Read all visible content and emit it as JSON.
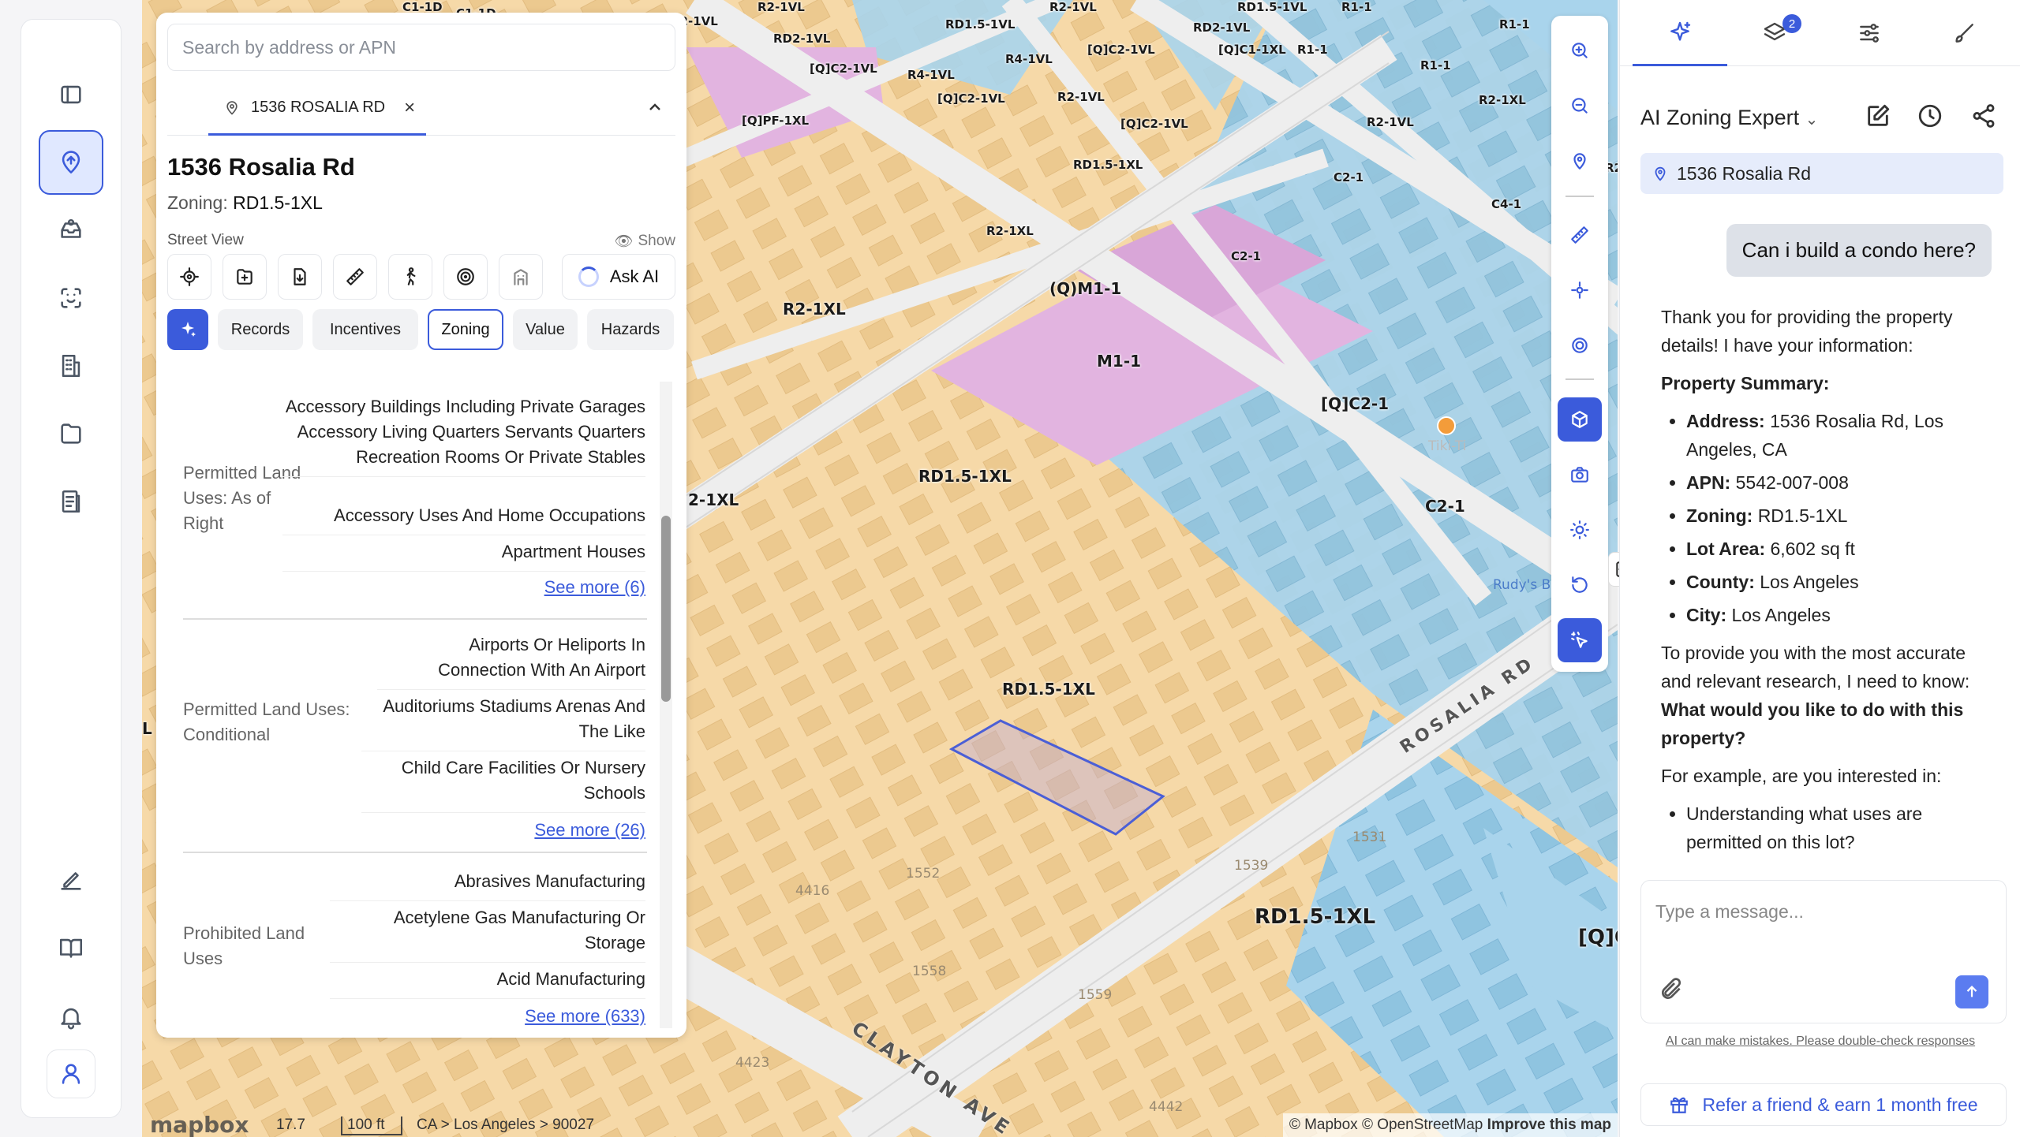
{
  "rail": {
    "items": [
      "sidebar-toggle",
      "map",
      "inbox",
      "ai-scan",
      "buildings",
      "folder",
      "reports",
      "edit",
      "guide",
      "notifications",
      "profile"
    ]
  },
  "panel": {
    "search_placeholder": "Search by address or APN",
    "tab_label": "1536 ROSALIA RD",
    "title": "1536 Rosalia Rd",
    "zoning_label": "Zoning:",
    "zoning_value": "RD1.5-1XL",
    "street_view": "Street View",
    "show": "Show",
    "ask_ai": "Ask AI",
    "tabs": [
      "Records",
      "Incentives",
      "Zoning",
      "Value",
      "Hazards"
    ],
    "selected_tab": "Zoning",
    "sections": [
      {
        "label": "Permitted Land Uses: As of Right",
        "items": [
          "Accessory Buildings Including Private Garages Accessory Living Quarters Servants Quarters Recreation Rooms Or Private Stables",
          "Accessory Uses And Home Occupations",
          "Apartment Houses"
        ],
        "more": "See more (6)"
      },
      {
        "label": "Permitted Land Uses: Conditional",
        "items": [
          "Airports Or Heliports In Connection With An Airport",
          "Auditoriums Stadiums Arenas And The Like",
          "Child Care Facilities Or Nursery Schools"
        ],
        "more": "See more (26)"
      },
      {
        "label": "Prohibited Land Uses",
        "items": [
          "Abrasives Manufacturing",
          "Acetylene Gas Manufacturing Or Storage",
          "Acid Manufacturing"
        ],
        "more": "See more (633)"
      }
    ]
  },
  "map": {
    "labels": {
      "rd15_top": "RD1.5-1XL",
      "rd15_mid": "RD1.5-1XL",
      "rd15_sel": "RD1.5-1XL",
      "rd15_bot": "RD1.5-1XL",
      "r21xl": "R2-1XL",
      "r21xl_b": "R2-1XL",
      "r21xl_c": "2-1XL",
      "m11": "M1-1",
      "qm11": "(Q)M1-1",
      "c21_a": "C2-1",
      "c21_b": "C2-1",
      "qc21": "[Q]C2-1",
      "c21_c": "C2-1",
      "c41": "C4-1",
      "qc_right": "[Q]C",
      "l_left": "L",
      "r2_1vl_a": "R2-1VL",
      "rd2_1vl": "RD2-1VL",
      "qc21vl_a": "[Q]C2-1VL",
      "qc21vl_b": "[Q]C2-1VL",
      "qc21vl_c": "[Q]C2-1VL",
      "r41vl": "R4-1VL",
      "r41vl_b": "R4-1VL",
      "qpf": "[Q]PF-1XL",
      "qc11vl": "[Q]C1-1XL",
      "r11": "R1-1",
      "r11_b": "R1-1",
      "r11_c": "R1-1",
      "r21vl_b": "R2-1VL",
      "rd15_1xl_s": "RD1.5-1XL",
      "rd15_1vl": "RD1.5-1VL",
      "c11d": "C1-1D",
      "c21_d": "C2-1",
      "r2_1xl_s": "R2-1XL",
      "r2_right": "R2-1XL",
      "r2_1vl_c": "R2-1VL",
      "r2_1vl_d": "R2-1VL",
      "r2_1vl_e": "R2-1VL",
      "r21xl_right": "R2-1XL",
      "r_edge": "R2",
      "rd15_1vl_b": "RD1.5-1VL",
      "rd21vl_b": "RD2-1VL",
      "c11d_b": "C1-1D",
      "qc21vl_d": "[Q]C2-1VL",
      "r11_d": "R1-1"
    },
    "streets": {
      "rosalia": "ROSALIA RD",
      "clayton": "CLAYTON AVE"
    },
    "poi": {
      "tiki": "Tiki-Ti",
      "rudys": "Rudy's B"
    },
    "addr": {
      "a4416": "4416",
      "a1552": "1552",
      "a1558": "1558",
      "a1559": "1559",
      "a1539": "1539",
      "a1531": "1531",
      "a4423": "4423",
      "a4442": "4442"
    },
    "footer": {
      "logo": "mapbox",
      "zoom": "17.7",
      "scale": "100 ft",
      "crumb": "CA > Los Angeles > 90027",
      "attr1": "© Mapbox",
      "attr2": "© OpenStreetMap",
      "attr3": "Improve this map"
    }
  },
  "chat": {
    "assistant": "AI Zoning Expert",
    "layers_badge": "2",
    "address": "1536 Rosalia Rd",
    "user_msg": "Can i build a condo here?",
    "reply": {
      "intro": "Thank you for providing the property details! I have your information:",
      "summary_heading": "Property Summary:",
      "facts": [
        {
          "k": "Address:",
          "v": "1536 Rosalia Rd, Los Angeles, CA"
        },
        {
          "k": "APN:",
          "v": "5542-007-008"
        },
        {
          "k": "Zoning:",
          "v": "RD1.5-1XL"
        },
        {
          "k": "Lot Area:",
          "v": "6,602 sq ft"
        },
        {
          "k": "County:",
          "v": "Los Angeles"
        },
        {
          "k": "City:",
          "v": "Los Angeles"
        }
      ],
      "ask": "To provide you with the most accurate and relevant research, I need to know:",
      "question": "What would you like to do with this property?",
      "example": "For example, are you interested in:",
      "bullets": [
        "Understanding what uses are permitted on this lot?"
      ]
    },
    "input_placeholder": "Type a message...",
    "disclaimer": "AI can make mistakes. Please double-check responses",
    "refer": "Refer a friend & earn 1 month free"
  }
}
